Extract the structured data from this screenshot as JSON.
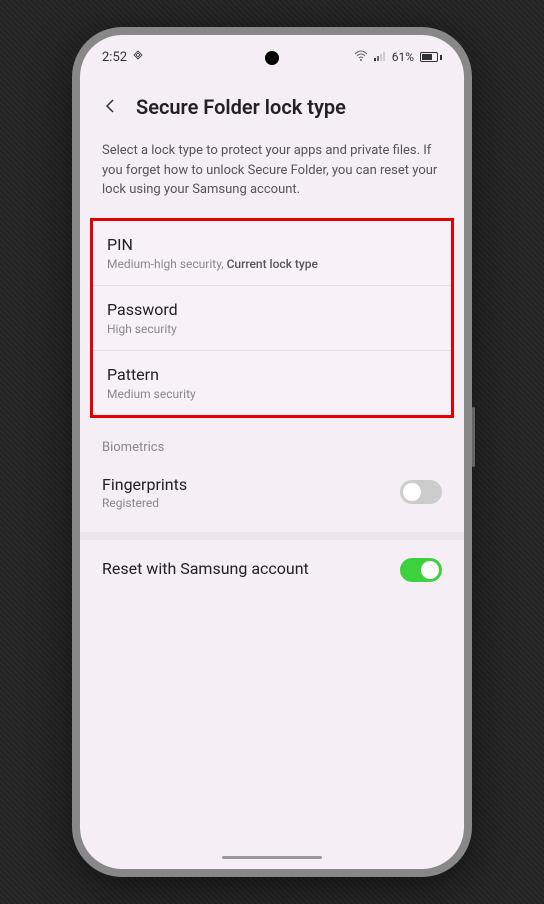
{
  "statusBar": {
    "time": "2:52",
    "batteryPercent": "61%"
  },
  "header": {
    "title": "Secure Folder lock type"
  },
  "description": "Select a lock type to protect your apps and private files. If you forget how to unlock Secure Folder, you can reset your lock using your Samsung account.",
  "lockOptions": [
    {
      "title": "PIN",
      "subtitle": "Medium-high security,",
      "currentLabel": "Current lock type"
    },
    {
      "title": "Password",
      "subtitle": "High security"
    },
    {
      "title": "Pattern",
      "subtitle": "Medium security"
    }
  ],
  "biometricsSection": {
    "header": "Biometrics",
    "fingerprints": {
      "title": "Fingerprints",
      "subtitle": "Registered",
      "enabled": false
    }
  },
  "resetOption": {
    "title": "Reset with Samsung account",
    "enabled": true
  }
}
